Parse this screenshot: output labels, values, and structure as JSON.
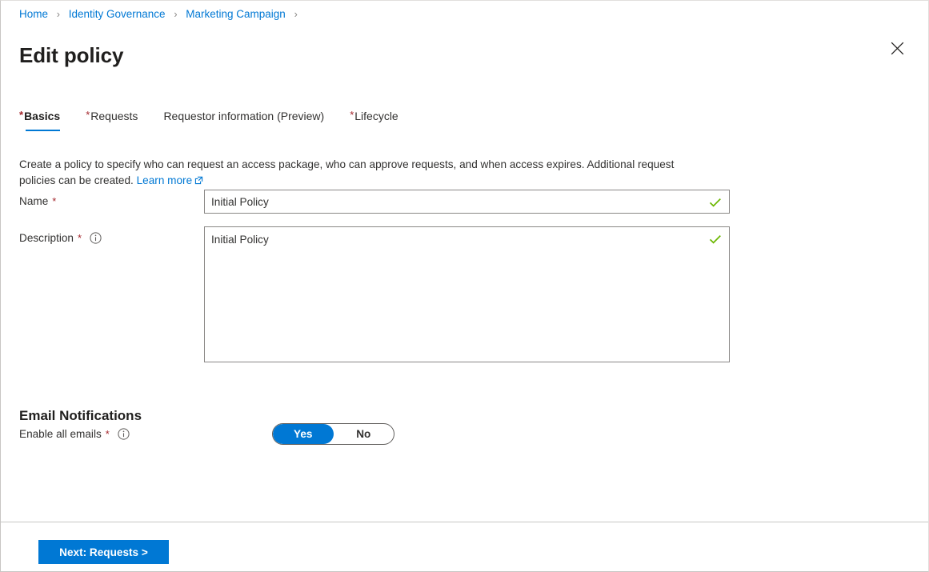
{
  "breadcrumb": {
    "separator": "›",
    "items": [
      {
        "label": "Home"
      },
      {
        "label": "Identity Governance"
      },
      {
        "label": "Marketing Campaign"
      }
    ]
  },
  "header": {
    "title": "Edit policy",
    "close_icon": "close-icon"
  },
  "tabs": [
    {
      "label": "Basics",
      "required": true,
      "selected": true
    },
    {
      "label": "Requests",
      "required": true,
      "selected": false
    },
    {
      "label": "Requestor information (Preview)",
      "required": false,
      "selected": false
    },
    {
      "label": "Lifecycle",
      "required": true,
      "selected": false
    }
  ],
  "intro": {
    "text": "Create a policy to specify who can request an access package, who can approve requests, and when access expires. Additional request policies can be created. ",
    "link_label": "Learn more"
  },
  "form": {
    "name": {
      "label": "Name",
      "required_marker": "*",
      "value": "Initial Policy",
      "placeholder": "",
      "validated": true
    },
    "description": {
      "label": "Description",
      "required_marker": "*",
      "value": "Initial Policy",
      "placeholder": "",
      "validated": true,
      "has_info": true
    }
  },
  "email_notifications": {
    "section_title": "Email Notifications",
    "field_label": "Enable all emails",
    "required_marker": "*",
    "has_info": true,
    "toggle": {
      "options": [
        "Yes",
        "No"
      ],
      "selected": "Yes"
    }
  },
  "footer": {
    "next_label": "Next: Requests >"
  },
  "colors": {
    "accent": "#0078d4",
    "required": "#a4262c",
    "valid": "#6bb700",
    "link": "#0078d4",
    "border": "#8a8886"
  }
}
